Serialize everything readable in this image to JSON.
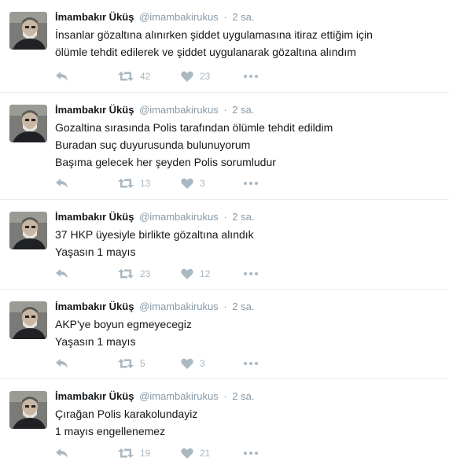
{
  "tweets": [
    {
      "name": "İmambakır Üküş",
      "handle": "@imambakirukus",
      "separator": "·",
      "time": "2 sa.",
      "lines": [
        "İnsanlar gözaltına alınırken şiddet uygulamasına itiraz ettiğim için",
        "ölümle tehdit edilerek ve şiddet uygulanarak gözaltına alındım"
      ],
      "retweets": "42",
      "likes": "23"
    },
    {
      "name": "İmambakır Üküş",
      "handle": "@imambakirukus",
      "separator": "·",
      "time": "2 sa.",
      "lines": [
        "Gozaltina sırasında Polis tarafından ölümle tehdit edildim",
        "Buradan suç duyurusunda bulunuyorum",
        "Başıma gelecek her şeyden Polis sorumludur"
      ],
      "retweets": "13",
      "likes": "3"
    },
    {
      "name": "İmambakır Üküş",
      "handle": "@imambakirukus",
      "separator": "·",
      "time": "2 sa.",
      "lines": [
        "37 HKP üyesiyle birlikte gözaltına alındık",
        "Yaşasın 1 mayıs"
      ],
      "retweets": "23",
      "likes": "12"
    },
    {
      "name": "İmambakır Üküş",
      "handle": "@imambakirukus",
      "separator": "·",
      "time": "2 sa.",
      "lines": [
        "AKP'ye boyun egmeyecegiz",
        "Yaşasın 1 mayıs"
      ],
      "retweets": "5",
      "likes": "3"
    },
    {
      "name": "İmambakır Üküş",
      "handle": "@imambakirukus",
      "separator": "·",
      "time": "2 sa.",
      "lines": [
        "Çırağan Polis karakolundayiz",
        "1 mayıs engellenemez"
      ],
      "retweets": "19",
      "likes": "21"
    }
  ],
  "icons": {
    "reply": "reply-icon",
    "retweet": "retweet-icon",
    "like": "heart-icon",
    "more": "more-dots-icon",
    "avatar": "avatar"
  },
  "colors": {
    "text": "#14171a",
    "muted": "#8899a6",
    "icon": "#aab8c2",
    "divider": "#e6ecf0"
  }
}
